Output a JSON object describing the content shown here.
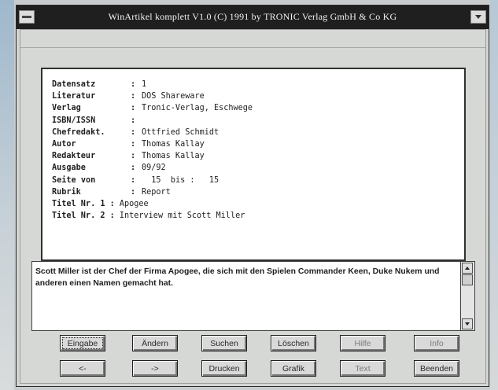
{
  "window": {
    "title": "WinArtikel komplett V1.0 (C) 1991 by TRONIC Verlag GmbH & Co KG"
  },
  "record": {
    "fields": [
      {
        "label": "Datensatz",
        "value": "1"
      },
      {
        "label": "Literatur",
        "value": "DOS Shareware"
      },
      {
        "label": "Verlag",
        "value": "Tronic-Verlag, Eschwege"
      },
      {
        "label": "ISBN/ISSN",
        "value": ""
      },
      {
        "label": "Chefredakt.",
        "value": "Ottfried Schmidt"
      },
      {
        "label": "Autor",
        "value": "Thomas Kallay"
      },
      {
        "label": "Redakteur",
        "value": "Thomas Kallay"
      },
      {
        "label": "Ausgabe",
        "value": "09/92"
      }
    ],
    "page_range": {
      "label": "Seite",
      "from_label": "von",
      "from": "15",
      "to_label": "bis",
      "to": "15"
    },
    "fields2": [
      {
        "label": "Rubrik",
        "value": "Report"
      },
      {
        "label": "Titel Nr. 1",
        "value": "Apogee"
      },
      {
        "label": "Titel Nr. 2",
        "value": "Interview mit Scott Miller"
      }
    ]
  },
  "memo": {
    "text": "Scott Miller ist der Chef der Firma Apogee, die sich mit den Spielen Commander Keen, Duke Nukem und anderen einen Namen gemacht hat."
  },
  "buttons": {
    "row1": [
      "Eingabe",
      "Ändern",
      "Suchen",
      "Löschen",
      "Hilfe",
      "Info"
    ],
    "row2": [
      "<-",
      "->",
      "Drucken",
      "Grafik",
      "Text",
      "Beenden"
    ]
  },
  "icons": {
    "system_menu": "system-menu-icon",
    "minimize": "minimize-icon",
    "scroll_up": "arrow-up-icon",
    "scroll_down": "arrow-down-icon"
  },
  "colors": {
    "titlebar": "#1f1f1f",
    "window_bg": "#d4d6d4",
    "field_bg": "#ffffff"
  }
}
